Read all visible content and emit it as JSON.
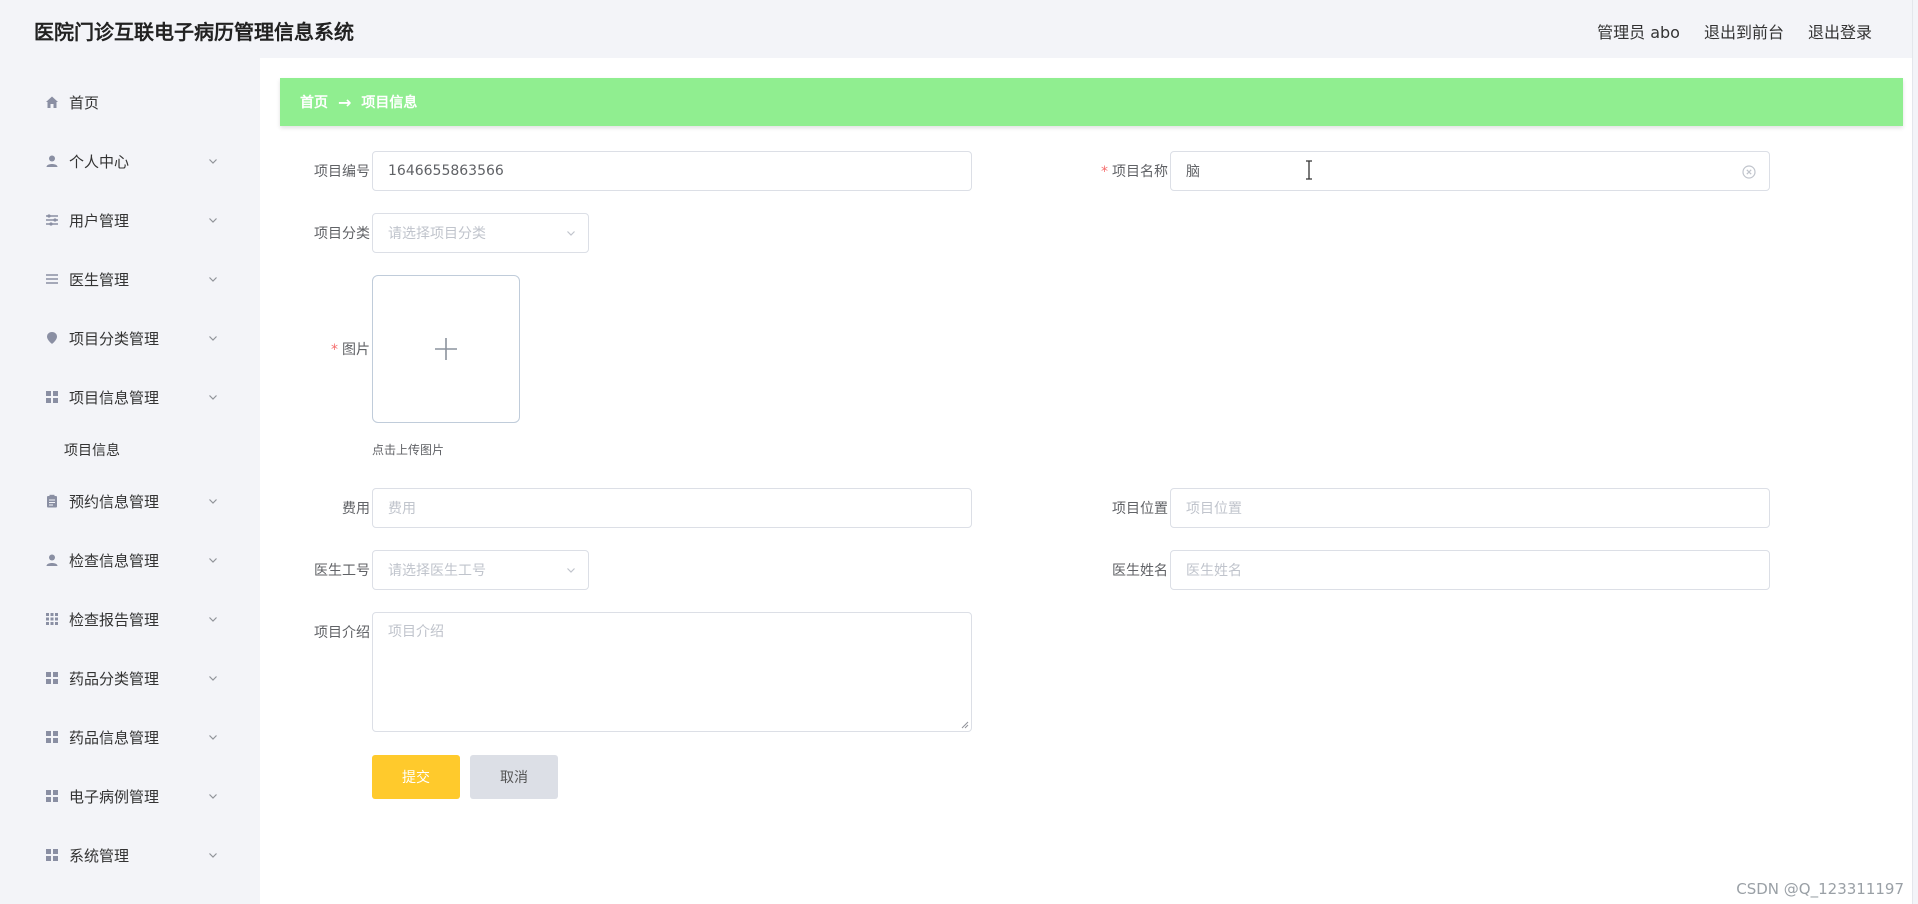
{
  "header": {
    "title": "医院门诊互联电子病历管理信息系统",
    "user": "管理员 abo",
    "to_front": "退出到前台",
    "logout": "退出登录"
  },
  "sidebar": {
    "items": [
      {
        "label": "首页",
        "icon": "home-icon"
      },
      {
        "label": "个人中心",
        "icon": "user-icon"
      },
      {
        "label": "用户管理",
        "icon": "sliders-icon"
      },
      {
        "label": "医生管理",
        "icon": "list-icon"
      },
      {
        "label": "项目分类管理",
        "icon": "location-icon"
      },
      {
        "label": "项目信息管理",
        "icon": "grid-icon"
      },
      {
        "label": "预约信息管理",
        "icon": "clipboard-icon"
      },
      {
        "label": "检查信息管理",
        "icon": "user-icon"
      },
      {
        "label": "检查报告管理",
        "icon": "apps-icon"
      },
      {
        "label": "药品分类管理",
        "icon": "grid-icon"
      },
      {
        "label": "药品信息管理",
        "icon": "grid-icon"
      },
      {
        "label": "电子病例管理",
        "icon": "grid-icon"
      },
      {
        "label": "系统管理",
        "icon": "grid-icon"
      }
    ],
    "sub_item": "项目信息"
  },
  "breadcrumb": {
    "home": "首页",
    "arrow": "→",
    "current": "项目信息"
  },
  "form": {
    "code_label": "项目编号",
    "code_value": "1646655863566",
    "name_label": "项目名称",
    "name_value": "脑",
    "category_label": "项目分类",
    "category_placeholder": "请选择项目分类",
    "image_label": "图片",
    "upload_hint": "点击上传图片",
    "fee_label": "费用",
    "fee_placeholder": "费用",
    "location_label": "项目位置",
    "location_placeholder": "项目位置",
    "doctor_id_label": "医生工号",
    "doctor_id_placeholder": "请选择医生工号",
    "doctor_name_label": "医生姓名",
    "doctor_name_placeholder": "医生姓名",
    "intro_label": "项目介绍",
    "intro_placeholder": "项目介绍",
    "required_mark": "*",
    "submit": "提交",
    "cancel": "取消"
  },
  "watermark": "CSDN @Q_123311197",
  "colors": {
    "breadcrumb_bg": "#90ee90",
    "submit_bg": "#ffca2c",
    "cancel_bg": "#dcdfe6",
    "sidebar_bg": "#f3f4f8"
  }
}
